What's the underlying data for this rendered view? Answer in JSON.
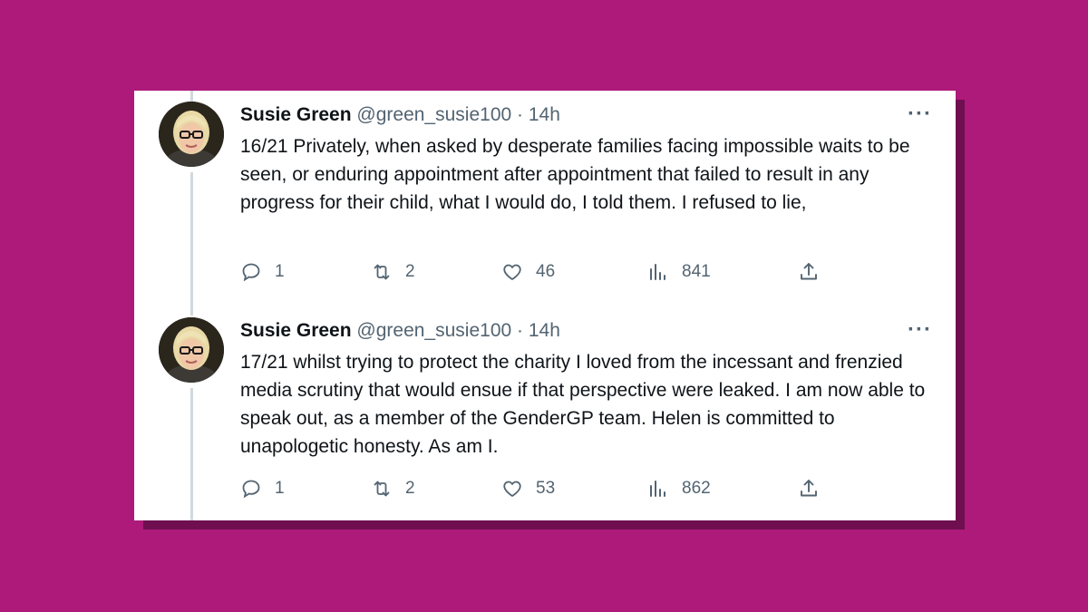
{
  "tweets": [
    {
      "name": "Susie Green",
      "handle": "@green_susie100",
      "separator": "·",
      "time": "14h",
      "more": "···",
      "text": "16/21 Privately, when asked by desperate families facing impossible waits to be seen, or enduring appointment after appointment that failed to result in any progress for their child, what I would do, I told them. I refused to lie,",
      "replies": "1",
      "retweets": "2",
      "likes": "46",
      "views": "841"
    },
    {
      "name": "Susie Green",
      "handle": "@green_susie100",
      "separator": "·",
      "time": "14h",
      "more": "···",
      "text": "17/21 whilst trying to protect the charity I loved from the incessant and frenzied media scrutiny that would ensue if that perspective were leaked. I am now able to speak out, as a member of the GenderGP team. Helen is committed to unapologetic honesty. As am I.",
      "replies": "1",
      "retweets": "2",
      "likes": "53",
      "views": "862"
    }
  ],
  "colors": {
    "background": "#ad1a7a",
    "card": "#ffffff",
    "text": "#0f1419",
    "muted": "#536471",
    "thread_line": "#cfd9de"
  },
  "icons": [
    "avatar-photo",
    "more-icon",
    "reply-icon",
    "retweet-icon",
    "like-icon",
    "views-icon",
    "share-icon"
  ]
}
